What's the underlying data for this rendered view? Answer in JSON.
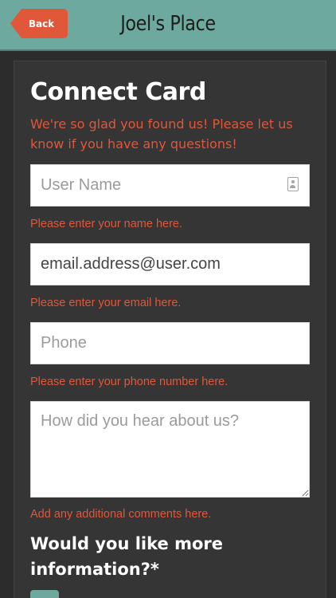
{
  "header": {
    "back_label": "Back",
    "title": "Joel's Place"
  },
  "form": {
    "title": "Connect Card",
    "subtitle": "We're so glad you found us!  Please let us know if you have any questions!",
    "fields": [
      {
        "placeholder": "User Name",
        "hint": "Please enter your name here."
      },
      {
        "placeholder": "email.address@user.com",
        "hint": "Please enter your email here."
      },
      {
        "placeholder": "Phone",
        "hint": "Please enter your phone number here."
      },
      {
        "placeholder": "How did you hear about us?",
        "hint": "Add any additional comments here."
      }
    ],
    "question": "Would you like more information?*"
  },
  "colors": {
    "accent": "#e0573a",
    "header_bg": "#6ea9a0",
    "page_bg": "#2c2c2c",
    "panel_bg": "#353535"
  },
  "icons": {
    "contact": "contact-card-icon"
  }
}
